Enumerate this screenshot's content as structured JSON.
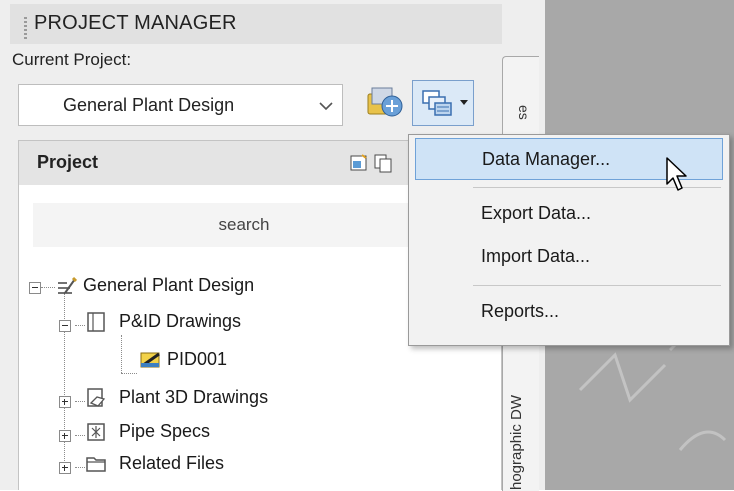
{
  "palette": {
    "title": "PROJECT MANAGER",
    "current_project_label": "Current Project:",
    "current_project_value": "General Plant Design",
    "side_tab_top": "es",
    "side_tab_bottom": "hographic DW"
  },
  "project_panel": {
    "title": "Project",
    "search_placeholder": "search",
    "tree": [
      {
        "label": "General Plant Design",
        "icon": "project-icon",
        "expanded": true
      },
      {
        "label": "P&ID Drawings",
        "icon": "pid-folder-icon",
        "expanded": true
      },
      {
        "label": "PID001",
        "icon": "pid-drawing-icon"
      },
      {
        "label": "Plant 3D Drawings",
        "icon": "plant3d-folder-icon",
        "expanded": false
      },
      {
        "label": "Pipe Specs",
        "icon": "pipe-specs-icon",
        "expanded": false
      },
      {
        "label": "Related Files",
        "icon": "folder-icon",
        "expanded": false
      }
    ]
  },
  "menu": {
    "items": [
      {
        "label": "Data Manager...",
        "highlighted": true
      },
      {
        "label": "Export Data..."
      },
      {
        "label": "Import Data..."
      },
      {
        "label": "Reports..."
      }
    ]
  },
  "colors": {
    "highlight": "#cfe3f6",
    "highlight_border": "#6fa2d8",
    "canvas": "#a8a8a8"
  }
}
